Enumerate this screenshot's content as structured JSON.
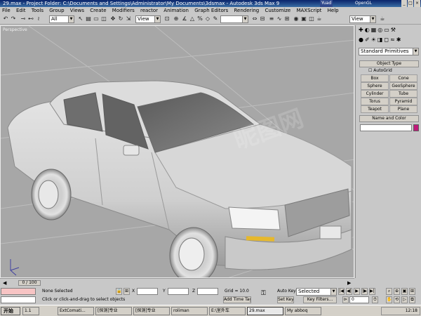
{
  "window": {
    "title": "29.max - Project Folder: C:\\Documents and Settings\\Administrator\\My Documents\\3dsmax - Autodesk 3ds Max 9",
    "ext_buttons": [
      "Yuad",
      "OpenGL"
    ]
  },
  "menu": {
    "items": [
      "File",
      "Edit",
      "Tools",
      "Group",
      "Views",
      "Create",
      "Modifiers",
      "reactor",
      "Animation",
      "Graph Editors",
      "Rendering",
      "Customize",
      "MAXScript",
      "Help"
    ]
  },
  "toolbar": {
    "selection_filter": "All",
    "reference_coord": "View",
    "named_selection": ""
  },
  "viewport": {
    "label": "Perspective",
    "watermark": "昵图网"
  },
  "command_panel": {
    "view_combo": "View",
    "category": "Standard Primitives",
    "object_type_title": "Object Type",
    "autogrid_label": "AutoGrid",
    "buttons": [
      "Box",
      "Cone",
      "Sphere",
      "GeoSphere",
      "Cylinder",
      "Tube",
      "Torus",
      "Pyramid",
      "Teapot",
      "Plane"
    ],
    "name_color_title": "Name and Color",
    "swatch_color": "#c0197a"
  },
  "timeline": {
    "frame": "0 / 100"
  },
  "status": {
    "selection": "None Selected",
    "prompt": "Click or click-and-drag to select objects",
    "x_label": "X",
    "y_label": "Y",
    "z_label": "Z",
    "grid": "Grid = 10.0",
    "add_time_tag": "Add Time Tag",
    "auto_key": "Auto Key",
    "set_key": "Set Key",
    "key_mode": "Selected",
    "key_filters": "Key Filters...",
    "frame_value": "0"
  },
  "taskbar": {
    "start": "开始",
    "tasks": [
      "1.1",
      "ExtComati...",
      "[探测]专业",
      "[探测]专业",
      "roliman",
      "E:\\室外车",
      "29.max",
      "My abboq"
    ],
    "clock": "12:18"
  }
}
